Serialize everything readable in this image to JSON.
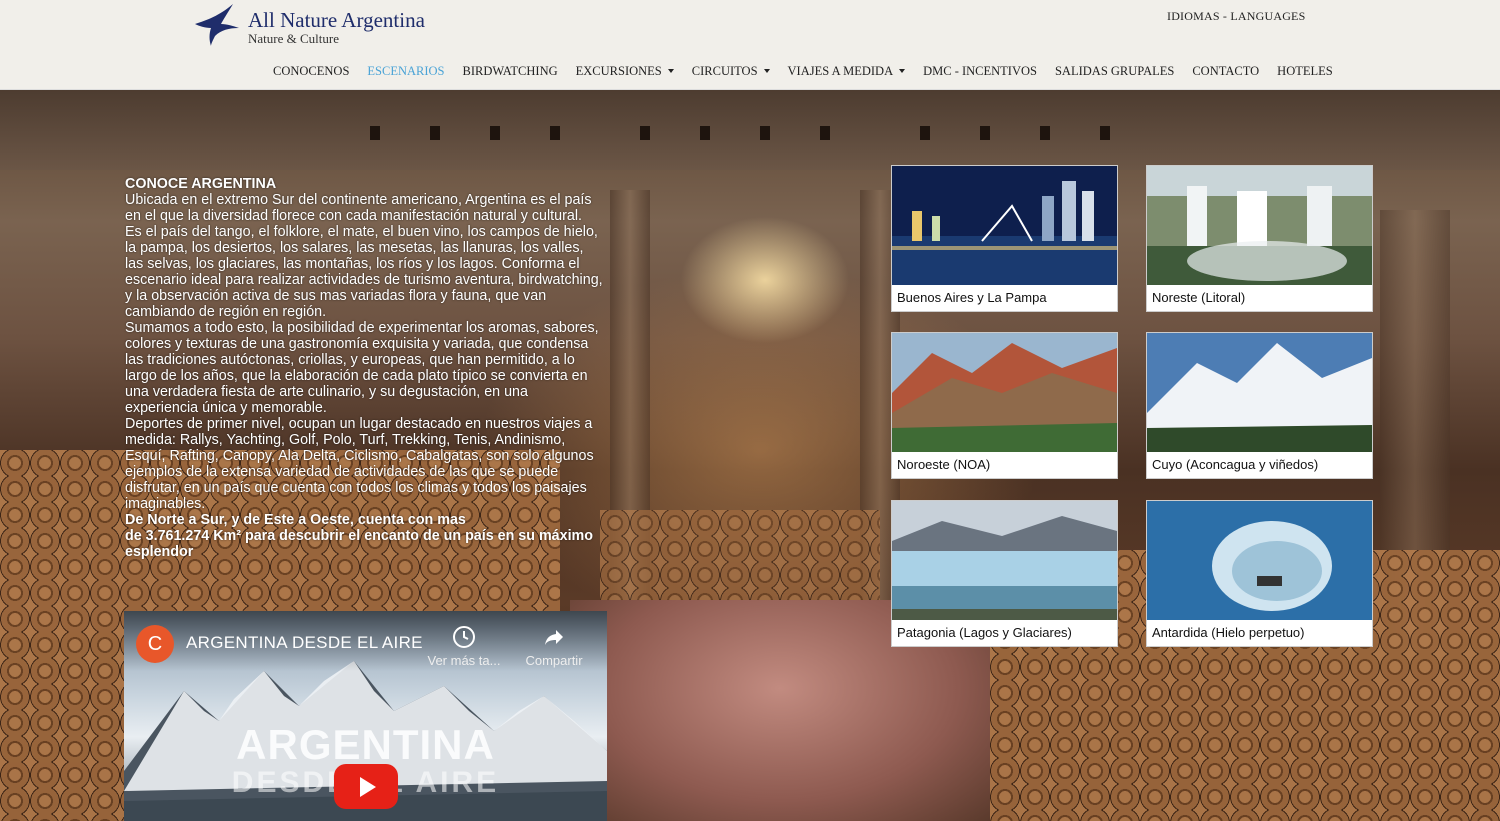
{
  "header": {
    "brand_name": "All Nature Argentina",
    "tagline": "Nature & Culture",
    "languages": "IDIOMAS - LANGUAGES"
  },
  "nav": {
    "items": [
      {
        "label": "CONOCENOS",
        "dropdown": false,
        "active": false
      },
      {
        "label": "ESCENARIOS",
        "dropdown": false,
        "active": true
      },
      {
        "label": "BIRDWATCHING",
        "dropdown": false,
        "active": false
      },
      {
        "label": "EXCURSIONES",
        "dropdown": true,
        "active": false
      },
      {
        "label": "CIRCUITOS",
        "dropdown": true,
        "active": false
      },
      {
        "label": "VIAJES A MEDIDA",
        "dropdown": true,
        "active": false
      },
      {
        "label": "DMC - INCENTIVOS",
        "dropdown": false,
        "active": false
      },
      {
        "label": "SALIDAS GRUPALES",
        "dropdown": false,
        "active": false
      },
      {
        "label": "CONTACTO",
        "dropdown": false,
        "active": false
      },
      {
        "label": "HOTELES",
        "dropdown": false,
        "active": false
      }
    ],
    "active_color": "#4aa3d6"
  },
  "intro": {
    "heading": "CONOCE ARGENTINA",
    "p1": "Ubicada en el extremo Sur del continente americano, Argentina es el país en el que la diversidad florece con cada manifestación natural y cultural.",
    "p2": "Es el país del tango, el folklore, el mate, el buen vino, los campos de hielo, la pampa, los desiertos, los salares, las mesetas, las llanuras, los valles, las selvas, los glaciares, las montañas, los ríos y los lagos. Conforma el escenario ideal para realizar actividades de turismo aventura, birdwatching, y la observación activa de sus mas variadas flora y fauna, que van cambiando de región en región.",
    "p3": "Sumamos a todo esto, la posibilidad de experimentar los aromas, sabores, colores y texturas de una gastronomía exquisita y variada, que condensa las tradiciones autóctonas, criollas, y europeas, que han permitido, a lo largo de los años, que la elaboración de cada plato típico se convierta en una verdadera fiesta de arte culinario, y su degustación, en una experiencia única y memorable.",
    "p4": "Deportes de primer nivel, ocupan un lugar destacado en nuestros viajes a medida: Rallys, Yachting, Golf, Polo, Turf, Trekking, Tenis, Andinismo, Esquí, Rafting, Canopy, Ala Delta, Ciclismo, Cabalgatas, son solo algunos ejemplos de la extensa variedad de actividades de las que se puede disfrutar, en un país que cuenta con todos los climas y todos los paisajes imaginables.",
    "bold_line1": "De Norte a Sur, y de Este a Oeste, cuenta con mas",
    "bold_line2": "de 3.761.274 Km² para descubrir el encanto de un país en su máximo esplendor"
  },
  "video": {
    "channel_initial": "C",
    "title": "ARGENTINA DESDE EL AIRE",
    "watch_later": "Ver más ta...",
    "share": "Compartir",
    "overlay_big": "ARGENTINA",
    "overlay_small": "DESDE EL AIRE"
  },
  "regions": [
    {
      "caption": "Buenos Aires y La Pampa",
      "icon": "city-skyline-image"
    },
    {
      "caption": "Noreste (Litoral)",
      "icon": "waterfalls-image"
    },
    {
      "caption": "Noroeste (NOA)",
      "icon": "colored-hills-image"
    },
    {
      "caption": "Cuyo (Aconcagua y viñedos)",
      "icon": "snowy-mountains-image"
    },
    {
      "caption": "Patagonia (Lagos y Glaciares)",
      "icon": "glacier-image"
    },
    {
      "caption": "Antardida (Hielo perpetuo)",
      "icon": "ice-cave-image"
    }
  ]
}
